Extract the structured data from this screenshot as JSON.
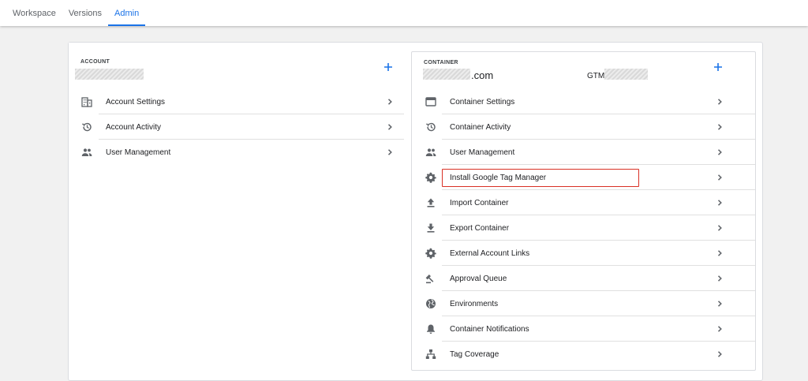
{
  "tabs": [
    {
      "label": "Workspace",
      "active": false
    },
    {
      "label": "Versions",
      "active": false
    },
    {
      "label": "Admin",
      "active": true
    }
  ],
  "account": {
    "section_label": "ACCOUNT",
    "add_icon": "plus-icon",
    "items": [
      {
        "label": "Account Settings",
        "icon": "building-icon"
      },
      {
        "label": "Account Activity",
        "icon": "history-icon"
      },
      {
        "label": "User Management",
        "icon": "people-icon"
      }
    ]
  },
  "container": {
    "section_label": "CONTAINER",
    "domain_suffix": ".com",
    "gtm_prefix": "GTM-",
    "add_icon": "plus-icon",
    "items": [
      {
        "label": "Container Settings",
        "icon": "browser-window-icon"
      },
      {
        "label": "Container Activity",
        "icon": "history-icon"
      },
      {
        "label": "User Management",
        "icon": "people-icon"
      },
      {
        "label": "Install Google Tag Manager",
        "icon": "gear-icon",
        "highlighted": true
      },
      {
        "label": "Import Container",
        "icon": "upload-icon"
      },
      {
        "label": "Export Container",
        "icon": "download-icon"
      },
      {
        "label": "External Account Links",
        "icon": "gear-icon"
      },
      {
        "label": "Approval Queue",
        "icon": "gavel-icon"
      },
      {
        "label": "Environments",
        "icon": "globe-icon"
      },
      {
        "label": "Container Notifications",
        "icon": "bell-icon"
      },
      {
        "label": "Tag Coverage",
        "icon": "sitemap-icon"
      }
    ]
  },
  "colors": {
    "accent": "#1a73e8",
    "highlight_border": "#d93025",
    "icon": "#5f6368"
  }
}
